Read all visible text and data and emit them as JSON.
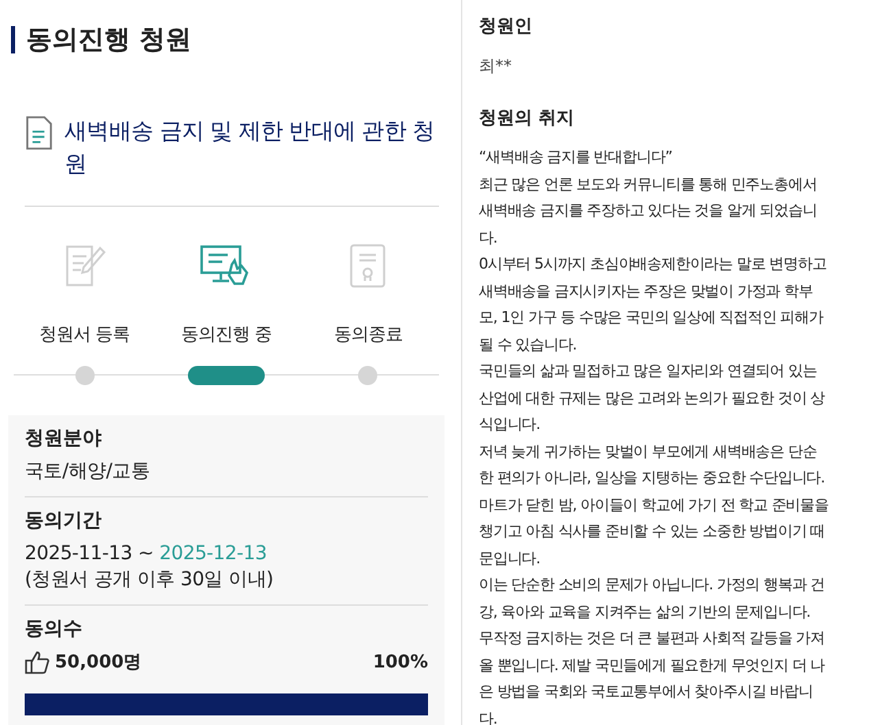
{
  "page_title": "동의진행 청원",
  "petition_title": "새벽배송 금지 및 제한 반대에 관한 청원",
  "steps": [
    {
      "label": "청원서 등록",
      "kind": "register",
      "selected": false
    },
    {
      "label": "동의진행 중",
      "kind": "progress",
      "selected": true
    },
    {
      "label": "동의종료",
      "kind": "closed",
      "selected": false
    }
  ],
  "field": {
    "label": "청원분야",
    "value": "국토/해양/교통"
  },
  "period": {
    "label": "동의기간",
    "start": "2025-11-13",
    "separator": "~",
    "end": "2025-12-13",
    "note": "(청원서 공개 이후 30일 이내)"
  },
  "agreements": {
    "label": "동의수",
    "count": "50,000명",
    "percent": "100%",
    "level": 1.0
  },
  "petitioner": {
    "label": "청원인",
    "value": "최**"
  },
  "purpose": {
    "label": "청원의 취지",
    "lines": [
      "“새벽배송 금지를 반대합니다”",
      "최근 많은 언론 보도와 커뮤니티를 통해 민주노총에서",
      "새벽배송 금지를 주장하고 있다는 것을 알게 되었습니",
      "다.",
      "0시부터 5시까지 초심야배송제한이라는 말로 변명하고",
      "새벽배송을 금지시키자는 주장은 맞벌이 가정과 학부",
      "모, 1인 가구 등 수많은 국민의 일상에 직접적인 피해가",
      "될 수 있습니다.",
      "국민들의 삶과 밀접하고 많은 일자리와 연결되어 있는",
      "산업에 대한 규제는 많은 고려와 논의가 필요한 것이 상",
      "식입니다.",
      "저녁 늦게 귀가하는 맞벌이 부모에게 새벽배송은 단순",
      "한 편의가 아니라, 일상을 지탱하는 중요한 수단입니다.",
      "마트가 닫힌 밤, 아이들이 학교에 가기 전 학교 준비물을",
      "챙기고 아침 식사를 준비할 수 있는 소중한 방법이기 때",
      "문입니다.",
      "이는 단순한 소비의 문제가 아닙니다. 가정의 행복과 건",
      "강, 육아와 교육을 지켜주는 삶의 기반의 문제입니다.",
      "무작정 금지하는 것은 더 큰 불편과 사회적 갈등을 가져",
      "올 뿐입니다. 제발 국민들에게 필요한게 무엇인지 더 나",
      "은 방법을 국회와 국토교통부에서 찾아주시길 바랍니",
      "다."
    ]
  }
}
